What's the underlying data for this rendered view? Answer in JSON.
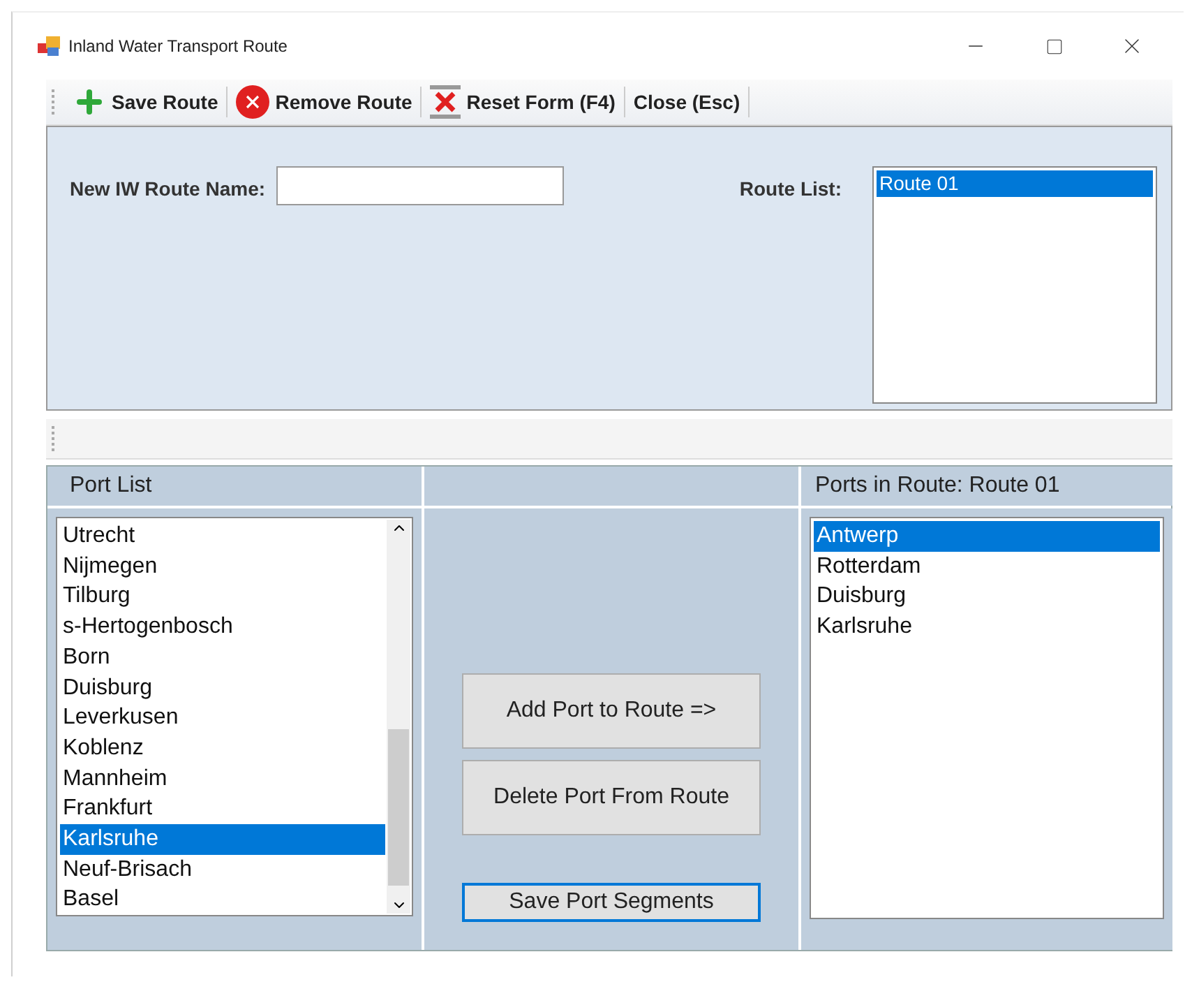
{
  "window": {
    "title": "Inland Water Transport Route"
  },
  "toolbar": [
    {
      "kind": "plus",
      "label": "Save Route"
    },
    {
      "kind": "remove",
      "label": "Remove Route"
    },
    {
      "kind": "reset",
      "label": "Reset Form (F4)"
    },
    {
      "kind": "plain",
      "label": "Close (Esc)"
    }
  ],
  "route_name": {
    "label": "New IW Route Name:"
  },
  "route_list": {
    "label": "Route List:",
    "items": [
      {
        "text": "Route 01",
        "selected": true
      }
    ]
  },
  "port_list": {
    "header": "Port List",
    "items": [
      {
        "text": "Utrecht",
        "selected": false
      },
      {
        "text": "Nijmegen",
        "selected": false
      },
      {
        "text": "Tilburg",
        "selected": false
      },
      {
        "text": "s-Hertogenbosch",
        "selected": false
      },
      {
        "text": "Born",
        "selected": false
      },
      {
        "text": "Duisburg",
        "selected": false
      },
      {
        "text": "Leverkusen",
        "selected": false
      },
      {
        "text": "Koblenz",
        "selected": false
      },
      {
        "text": "Mannheim",
        "selected": false
      },
      {
        "text": "Frankfurt",
        "selected": false
      },
      {
        "text": "Karlsruhe",
        "selected": true
      },
      {
        "text": "Neuf-Brisach",
        "selected": false
      },
      {
        "text": "Basel",
        "selected": false
      }
    ]
  },
  "actions": [
    {
      "label": "Add Port to Route =>",
      "focused": false
    },
    {
      "label": "Delete Port From Route",
      "focused": false
    },
    {
      "label": "Save Port Segments",
      "focused": true
    }
  ],
  "route_ports": {
    "header": "Ports in Route: Route 01",
    "items": [
      {
        "text": "Antwerp",
        "selected": true
      },
      {
        "text": "Rotterdam",
        "selected": false
      },
      {
        "text": "Duisburg",
        "selected": false
      },
      {
        "text": "Karlsruhe",
        "selected": false
      }
    ]
  }
}
